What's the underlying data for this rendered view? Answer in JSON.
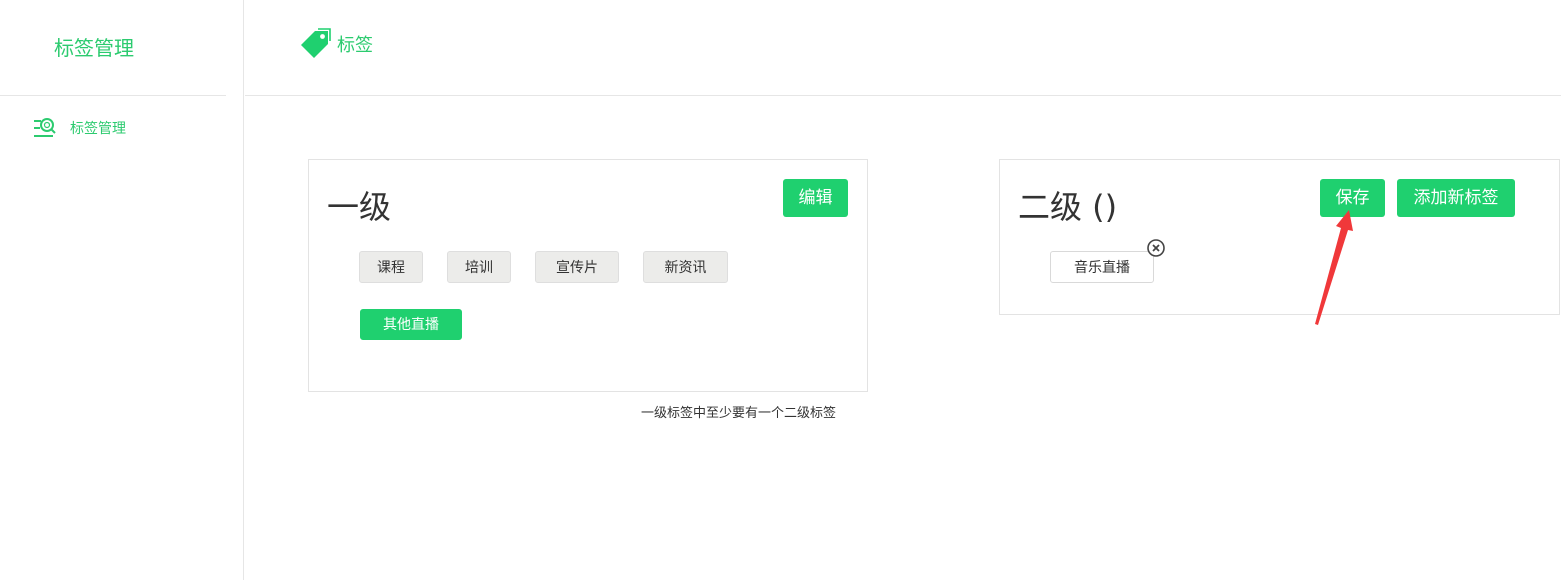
{
  "sidebar": {
    "app_title": "标签管理",
    "items": [
      {
        "label": "标签管理",
        "icon": "search-list-icon"
      }
    ]
  },
  "header": {
    "breadcrumb": {
      "label": "标签",
      "icon": "tag-icon"
    }
  },
  "level1": {
    "title": "一级",
    "edit_label": "编辑",
    "tags": [
      {
        "label": "课程",
        "active": false
      },
      {
        "label": "培训",
        "active": false
      },
      {
        "label": "宣传片",
        "active": false
      },
      {
        "label": "新资讯",
        "active": false
      },
      {
        "label": "其他直播",
        "active": true
      }
    ],
    "hint": "一级标签中至少要有一个二级标签"
  },
  "level2": {
    "title": "二级 ()",
    "save_label": "保存",
    "add_label": "添加新标签",
    "tags": [
      {
        "label": "音乐直播"
      }
    ]
  },
  "colors": {
    "accent": "#1fd06f",
    "accent_text": "#2ccb6f",
    "chip_bg": "#ececea",
    "annotation_arrow": "#f0383a"
  }
}
